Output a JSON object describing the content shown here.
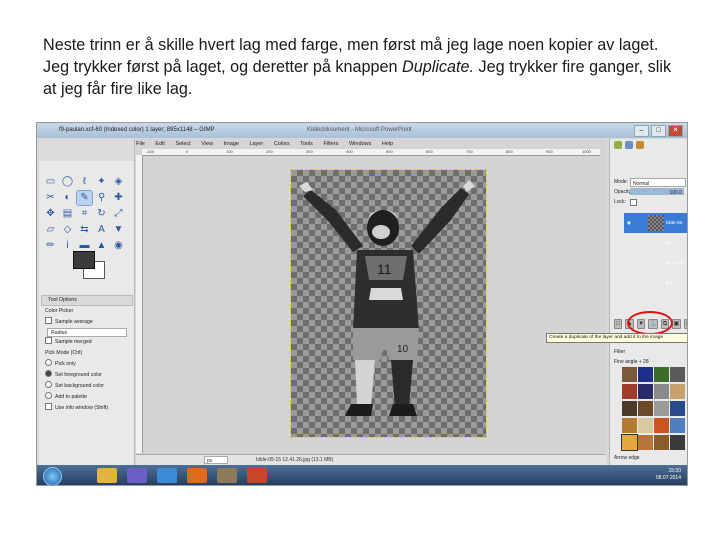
{
  "caption": {
    "part1": "Neste trinn er å skille hvert lag med farge, men først må jeg lage noen kopier av laget. Jeg trykker først på laget, og deretter på knappen ",
    "emph": "Duplicate.",
    "part2": " Jeg trykker fire ganger, slik at jeg får fire like lag."
  },
  "window": {
    "title": "f9-paulan.xcf-60 (Indexed color) 1 layer; 895x1148 – GIMP",
    "ghost_title": "Kildedoksument - Microsoft PowerPoint"
  },
  "image_menu": [
    "File",
    "Edit",
    "Select",
    "View",
    "Image",
    "Layer",
    "Colors",
    "Tools",
    "Filters",
    "Windows",
    "Help"
  ],
  "ruler_marks": [
    "-100",
    "0",
    "100",
    "200",
    "300",
    "400",
    "500",
    "600",
    "700",
    "800",
    "900",
    "1000"
  ],
  "tool_options": {
    "tab": "Tool Options",
    "title": "Color Picker",
    "sample_average": "Sample average",
    "radius": "Radius",
    "sample_merged": "Sample merged",
    "pick_mode": "Pick Mode (Ctrl)",
    "modes": [
      "Pick only",
      "Set foreground color",
      "Set background color",
      "Add to palette"
    ],
    "info_window": "Use info window (Shift)"
  },
  "status": {
    "zoom": "px",
    "text": "bilde-05-15 12.41.26.jpg (13.1 MB)"
  },
  "layers": {
    "mode_label": "Mode:",
    "mode_value": "Normal",
    "opacity_label": "Opacity",
    "opacity_value": "100.0",
    "lock_label": "Lock:",
    "layer_name": "bilde-05-15 12.41.26 jpg",
    "tooltip": "Create a duplicate of the layer and add it to the image",
    "filter_label": "Filter",
    "brush_label": "Fine angle + 28",
    "bottom_label": "Arrow edge"
  },
  "clock": {
    "time": "15:00",
    "date": "08.07.2014"
  },
  "colors": {
    "selection_blue": "#3a7bd5",
    "highlight_red": "#dd1111",
    "fg_color": "#3b3b3b",
    "bg_color": "#ffffff"
  }
}
